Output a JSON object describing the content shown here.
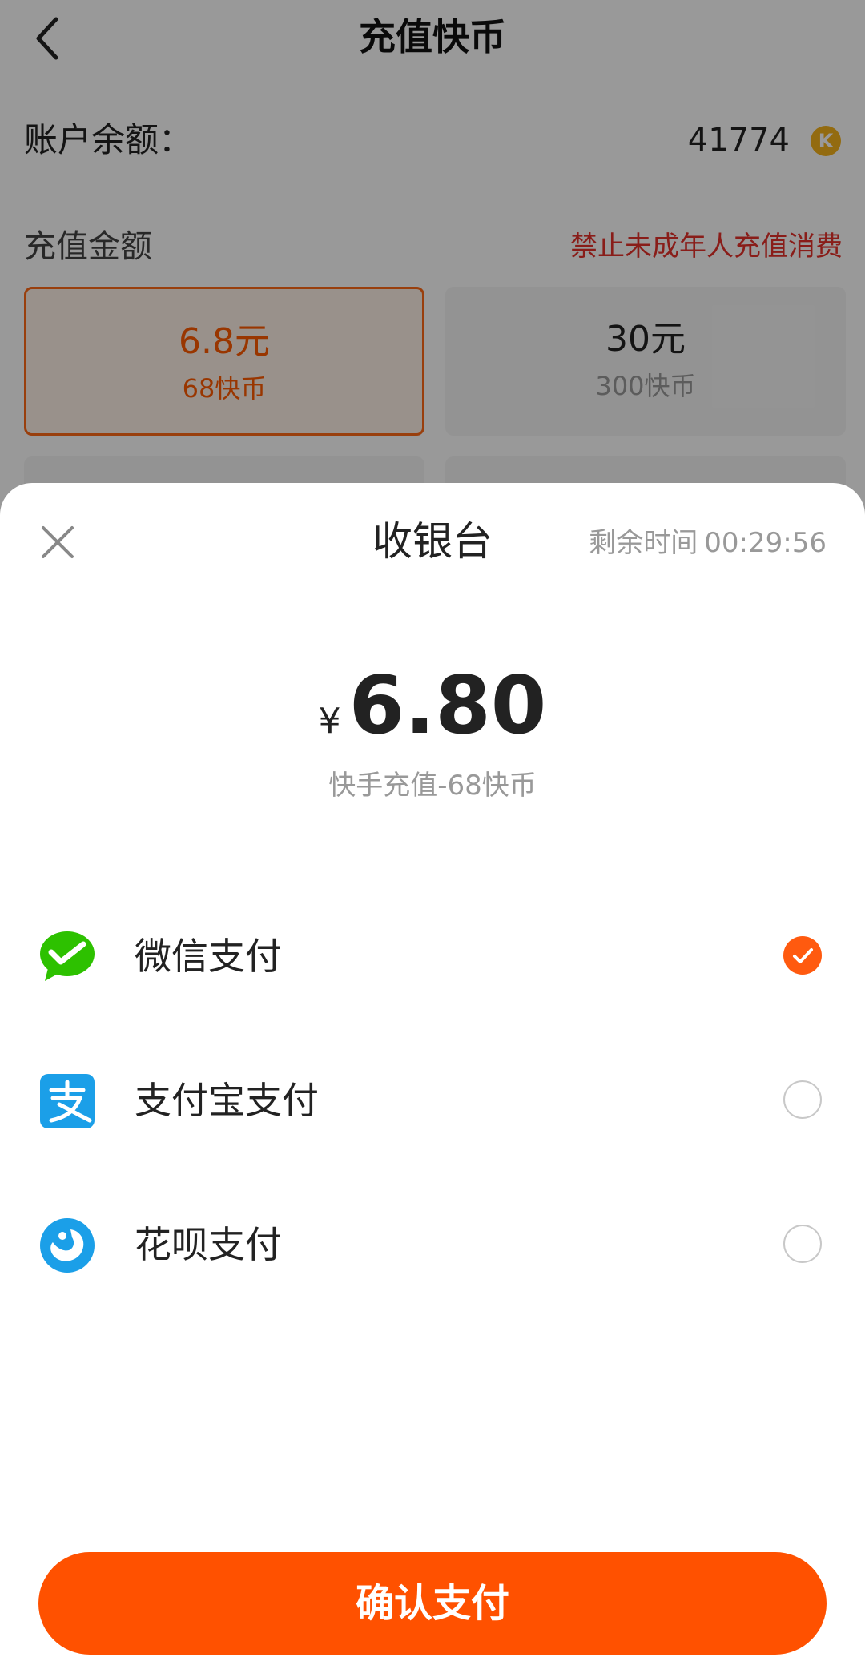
{
  "header": {
    "title": "充值快币"
  },
  "balance": {
    "label": "账户余额：",
    "value": "41774",
    "coin_icon_letter": "K"
  },
  "amount": {
    "label": "充值金额",
    "warning": "禁止未成年人充值消费"
  },
  "options": [
    {
      "price": "6.8元",
      "coins": "68快币",
      "selected": true
    },
    {
      "price": "30元",
      "coins": "300快币",
      "selected": false
    }
  ],
  "cashier": {
    "title": "收银台",
    "countdown_label": "剩余时间",
    "countdown_value": "00:29:56",
    "currency": "¥",
    "amount": "6.80",
    "description": "快手充值-68快币"
  },
  "payment_methods": [
    {
      "label": "微信支付",
      "icon": "wechat-pay-icon",
      "checked": true
    },
    {
      "label": "支付宝支付",
      "icon": "alipay-icon",
      "checked": false
    },
    {
      "label": "花呗支付",
      "icon": "huabei-icon",
      "checked": false
    }
  ],
  "confirm_label": "确认支付",
  "colors": {
    "accent": "#ff5100",
    "warning": "#e5312b",
    "wechat": "#2dc100",
    "alipay": "#1b9fe8"
  }
}
